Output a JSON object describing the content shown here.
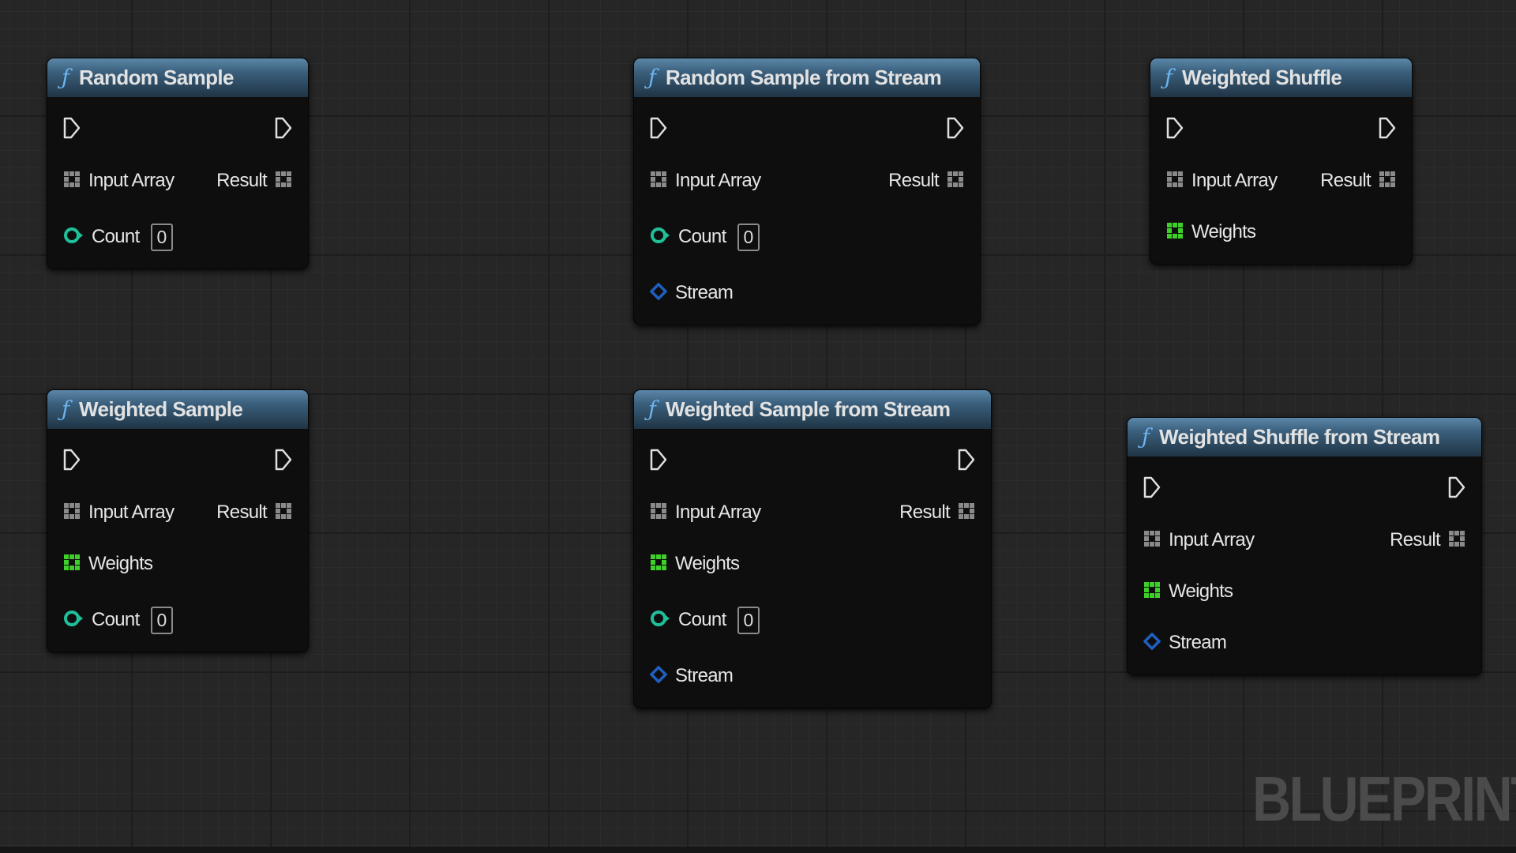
{
  "watermark": "BLUEPRINT",
  "colors": {
    "header": "#3a5f7c",
    "function_icon": "#6cb4f0",
    "array_pin": "#8a8a8a",
    "weights_pin": "#3fcf2a",
    "count_pin": "#1fbf9a",
    "stream_pin": "#1f5fbf",
    "exec_pin": "#e0e0e0"
  },
  "nodes": [
    {
      "id": "n1",
      "title": "Random Sample",
      "icon": "function-icon",
      "rows": [
        {
          "type": "array",
          "label": "Input Array",
          "right": "Result"
        },
        {
          "type": "count",
          "label": "Count",
          "value": "0"
        }
      ]
    },
    {
      "id": "n2",
      "title": "Random Sample from Stream",
      "icon": "function-icon",
      "rows": [
        {
          "type": "array",
          "label": "Input Array",
          "right": "Result"
        },
        {
          "type": "count",
          "label": "Count",
          "value": "0"
        },
        {
          "type": "stream",
          "label": "Stream"
        }
      ]
    },
    {
      "id": "n3",
      "title": "Weighted Shuffle",
      "icon": "function-icon",
      "rows": [
        {
          "type": "array",
          "label": "Input Array",
          "right": "Result"
        },
        {
          "type": "weights",
          "label": "Weights"
        }
      ]
    },
    {
      "id": "n4",
      "title": "Weighted Sample",
      "icon": "function-icon",
      "rows": [
        {
          "type": "array",
          "label": "Input Array",
          "right": "Result"
        },
        {
          "type": "weights",
          "label": "Weights"
        },
        {
          "type": "count",
          "label": "Count",
          "value": "0"
        }
      ]
    },
    {
      "id": "n5",
      "title": "Weighted Sample from Stream",
      "icon": "function-icon",
      "rows": [
        {
          "type": "array",
          "label": "Input Array",
          "right": "Result"
        },
        {
          "type": "weights",
          "label": "Weights"
        },
        {
          "type": "count",
          "label": "Count",
          "value": "0"
        },
        {
          "type": "stream",
          "label": "Stream"
        }
      ]
    },
    {
      "id": "n6",
      "title": "Weighted Shuffle from Stream",
      "icon": "function-icon",
      "rows": [
        {
          "type": "array",
          "label": "Input Array",
          "right": "Result"
        },
        {
          "type": "weights",
          "label": "Weights"
        },
        {
          "type": "stream",
          "label": "Stream"
        }
      ]
    }
  ]
}
